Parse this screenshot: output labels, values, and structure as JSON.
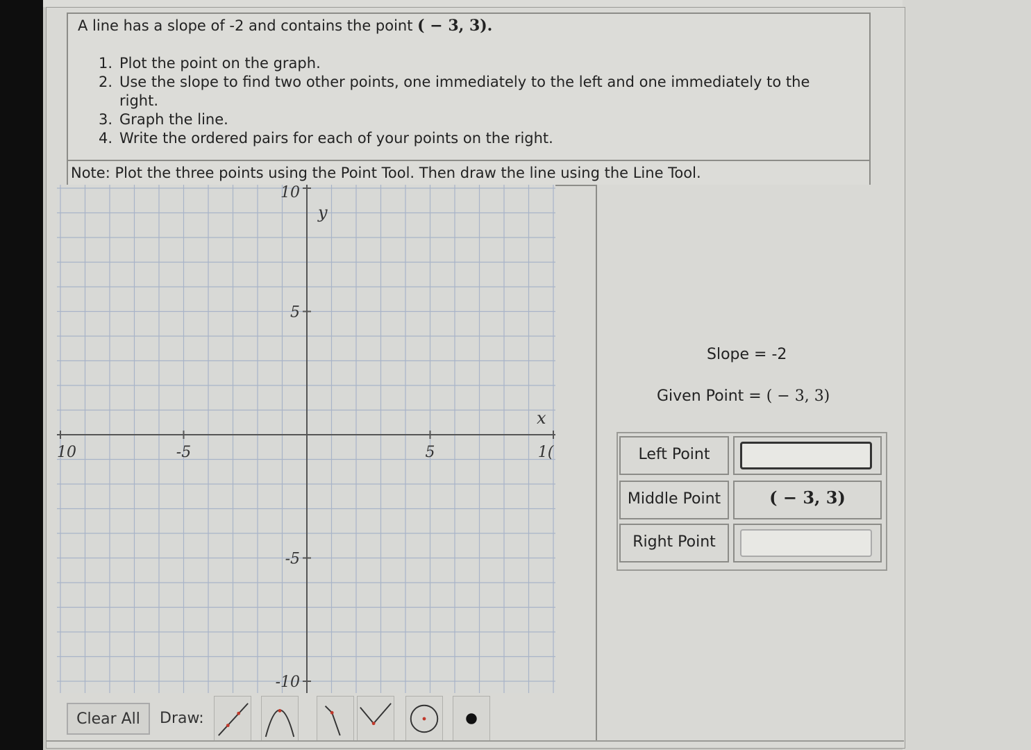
{
  "problem": {
    "prompt_text": "A line has a slope of -2 and contains the point",
    "prompt_point": "( − 3, 3).",
    "steps": [
      {
        "num": "1.",
        "text": "Plot the point on the graph."
      },
      {
        "num": "2.",
        "text": "Use the slope to find two other points, one immediately to the left and one immediately to the right."
      },
      {
        "num": "3.",
        "text": "Graph the line."
      },
      {
        "num": "4.",
        "text": "Write the ordered pairs for each of your points on the right."
      }
    ],
    "note": "Note: Plot the three points using the Point Tool. Then draw the line using the Line Tool."
  },
  "graph": {
    "x_axis_label": "x",
    "y_axis_label": "y",
    "x_min": -10,
    "x_max": 10,
    "y_min": -10,
    "y_max": 10,
    "x_tick_labels": [
      "10",
      "-5",
      "5",
      "1("
    ],
    "y_tick_labels": [
      "10",
      "5",
      "-5",
      "-10"
    ],
    "grid_step": 1
  },
  "info": {
    "slope_text": "Slope = -2",
    "given_label": "Given Point = ",
    "given_value": "( − 3, 3)"
  },
  "points_table": {
    "left_label": "Left Point",
    "left_value": "",
    "middle_label": "Middle Point",
    "middle_value": "( − 3, 3)",
    "right_label": "Right Point",
    "right_value": ""
  },
  "toolbar": {
    "clear_label": "Clear All",
    "draw_label": "Draw:",
    "tools": [
      "line-tool-icon",
      "parabola-tool-icon",
      "ray-tool-icon",
      "absolute-value-tool-icon",
      "circle-tool-icon",
      "point-tool-icon"
    ]
  },
  "colors": {
    "grid": "#a8b4c8",
    "axis": "#555555",
    "tool_red": "#c0392b"
  }
}
